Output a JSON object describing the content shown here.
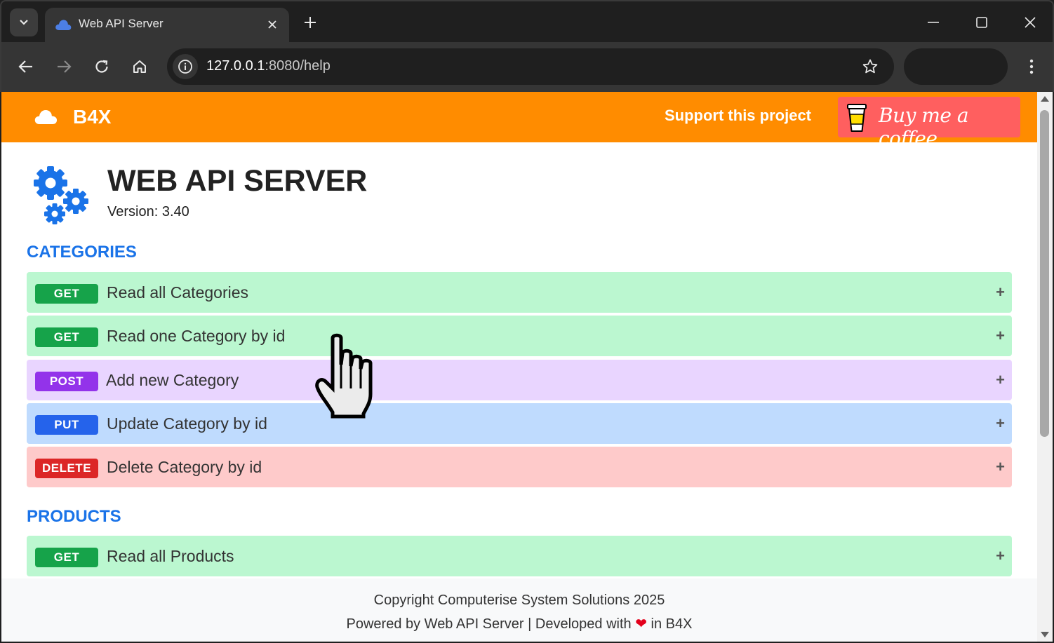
{
  "browser": {
    "tab_title": "Web API Server",
    "url_host": "127.0.0.1",
    "url_rest": ":8080/help"
  },
  "header": {
    "brand": "B4X",
    "support_text": "Support this project",
    "bmc_label": "Buy me a coffee"
  },
  "page": {
    "title": "WEB API SERVER",
    "version_label": "Version:",
    "version_value": "3.40"
  },
  "sections": [
    {
      "heading": "CATEGORIES",
      "endpoints": [
        {
          "method": "GET",
          "label": "Read all Categories"
        },
        {
          "method": "GET",
          "label": "Read one Category by id"
        },
        {
          "method": "POST",
          "label": "Add new Category"
        },
        {
          "method": "PUT",
          "label": "Update Category by id"
        },
        {
          "method": "DELETE",
          "label": "Delete Category by id"
        }
      ]
    },
    {
      "heading": "PRODUCTS",
      "endpoints": [
        {
          "method": "GET",
          "label": "Read all Products"
        }
      ]
    }
  ],
  "expand_symbol": "+",
  "footer": {
    "copyright": "Copyright Computerise System Solutions 2025",
    "powered_prefix": "Powered by Web API Server | Developed with",
    "heart": "❤",
    "powered_suffix": "in B4X"
  },
  "colors": {
    "header_bg": "#ff8c00",
    "heading_blue": "#1a73e8",
    "get": "#16a34a",
    "post": "#9333ea",
    "put": "#2563eb",
    "delete": "#dc2626"
  }
}
